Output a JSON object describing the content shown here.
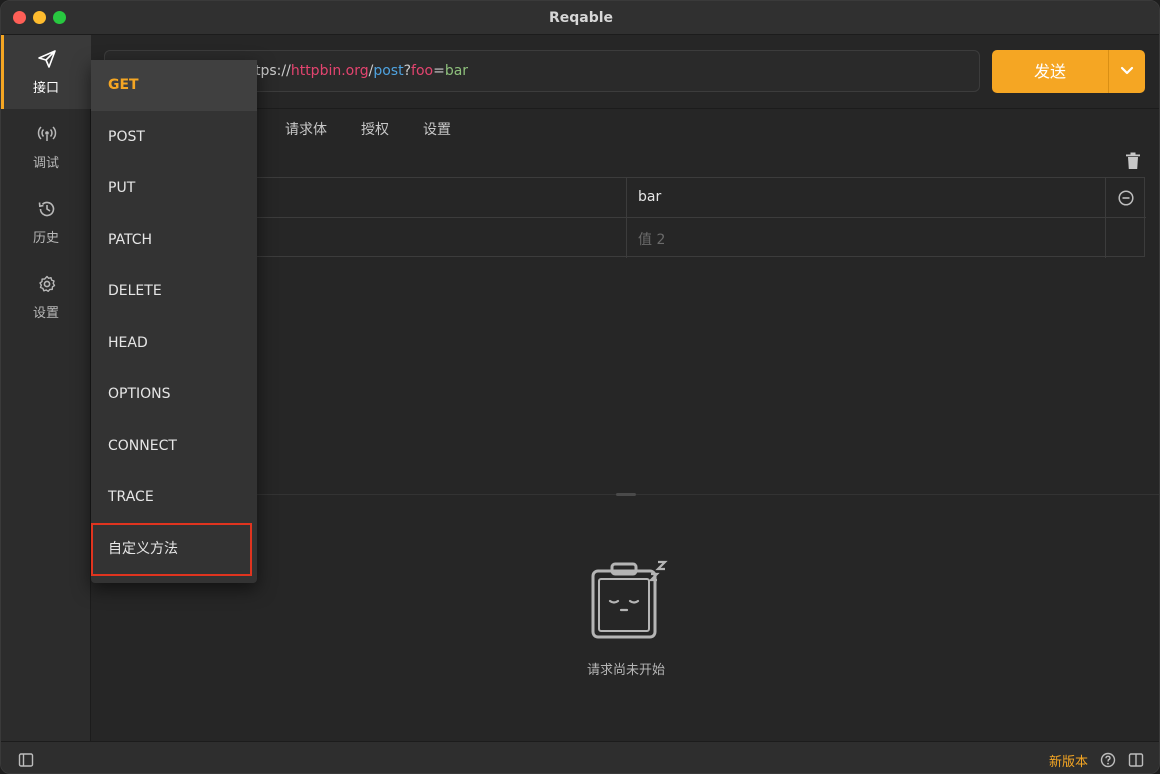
{
  "window": {
    "title": "Reqable"
  },
  "sidebar": {
    "items": [
      {
        "label": "接口",
        "icon": "send-icon",
        "active": true
      },
      {
        "label": "调试",
        "icon": "antenna-icon",
        "active": false
      },
      {
        "label": "历史",
        "icon": "history-icon",
        "active": false
      },
      {
        "label": "设置",
        "icon": "gear-icon",
        "active": false
      }
    ]
  },
  "request": {
    "url_parts": {
      "prefix": "tps://",
      "host": "httpbin.org",
      "slash": "/",
      "path": "post",
      "q": "?",
      "key": "foo",
      "eq": "=",
      "val": "bar"
    },
    "send_label": "发送"
  },
  "tabs": [
    "请求体",
    "授权",
    "设置"
  ],
  "params": {
    "rows": [
      {
        "value": "bar"
      },
      {
        "value_placeholder": "值 2"
      }
    ]
  },
  "response": {
    "empty_text": "请求尚未开始"
  },
  "statusbar": {
    "new_version": "新版本"
  },
  "method_menu": {
    "items": [
      "GET",
      "POST",
      "PUT",
      "PATCH",
      "DELETE",
      "HEAD",
      "OPTIONS",
      "CONNECT",
      "TRACE",
      "自定义方法"
    ],
    "selected": "GET"
  },
  "colors": {
    "accent": "#f5a623",
    "highlight": "#e0341f"
  }
}
